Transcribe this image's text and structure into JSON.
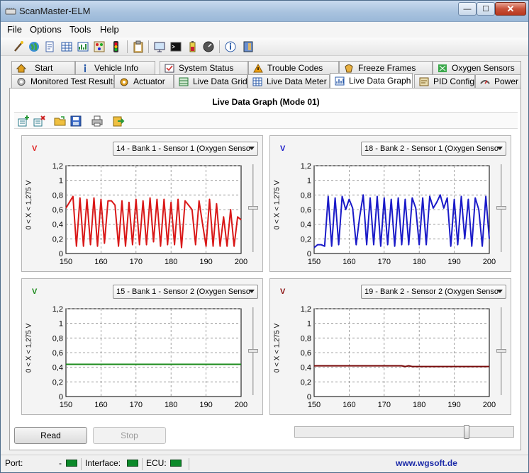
{
  "window": {
    "title": "ScanMaster-ELM",
    "minimize": "—",
    "maximize": "☐",
    "close": "✕"
  },
  "menu": [
    "File",
    "Options",
    "Tools",
    "Help"
  ],
  "toolbar_icons": [
    "wand-icon",
    "globe-icon",
    "document-icon",
    "grid-icon",
    "chart-icon",
    "palette-icon",
    "traffic-light-icon",
    "clipboard-icon",
    "monitor-icon",
    "terminal-icon",
    "battery-icon",
    "gauge-icon",
    "info-icon",
    "connect-icon"
  ],
  "tabs_back": [
    {
      "label": "Start",
      "icon": "home-icon"
    },
    {
      "label": "Vehicle Info",
      "icon": "info-icon"
    },
    {
      "label": "System Status",
      "icon": "checklist-icon"
    },
    {
      "label": "Trouble Codes",
      "icon": "warning-icon"
    },
    {
      "label": "Freeze Frames",
      "icon": "freeze-icon"
    },
    {
      "label": "Oxygen Sensors",
      "icon": "sensor-icon"
    }
  ],
  "tabs_front": [
    {
      "label": "Monitored Test Results",
      "icon": "gear-icon"
    },
    {
      "label": "Actuator",
      "icon": "actuator-icon"
    },
    {
      "label": "Live Data Grid",
      "icon": "grid-icon"
    },
    {
      "label": "Live Data Meter",
      "icon": "meter-icon"
    },
    {
      "label": "Live Data Graph",
      "icon": "graph-icon",
      "active": true
    },
    {
      "label": "PID Config",
      "icon": "config-icon"
    },
    {
      "label": "Power",
      "icon": "power-icon"
    }
  ],
  "graph_title": "Live Data Graph (Mode 01)",
  "y_axis_label": "0  < X <  1,275  V",
  "panels": [
    {
      "vlabel": "V",
      "vcolor": "#e02020",
      "pid": "14 - Bank 1 - Sensor 1 (Oxygen Senso",
      "line_color": "#d91818",
      "chart_data": {
        "type": "line",
        "xlim": [
          150,
          200
        ],
        "ylim": [
          0,
          1.2
        ],
        "x_ticks": [
          "150",
          "160",
          "170",
          "180",
          "190",
          "200"
        ],
        "y_ticks": [
          "0",
          "0,2",
          "0,4",
          "0,6",
          "0,8",
          "1",
          "1,2"
        ],
        "x": [
          150,
          151,
          152,
          153,
          154,
          155,
          156,
          157,
          158,
          159,
          160,
          161,
          162,
          163,
          164,
          165,
          166,
          167,
          168,
          169,
          170,
          171,
          172,
          173,
          174,
          175,
          176,
          177,
          178,
          179,
          180,
          181,
          182,
          183,
          184,
          185,
          186,
          187,
          188,
          189,
          190,
          191,
          192,
          193,
          194,
          195,
          196,
          197,
          198,
          199,
          200
        ],
        "y": [
          0.62,
          0.7,
          0.78,
          0.1,
          0.76,
          0.1,
          0.74,
          0.12,
          0.76,
          0.1,
          0.74,
          0.14,
          0.72,
          0.72,
          0.66,
          0.1,
          0.72,
          0.1,
          0.7,
          0.12,
          0.74,
          0.12,
          0.72,
          0.12,
          0.76,
          0.16,
          0.74,
          0.1,
          0.74,
          0.12,
          0.7,
          0.12,
          0.74,
          0.08,
          0.72,
          0.66,
          0.6,
          0.12,
          0.72,
          0.4,
          0.1,
          0.74,
          0.1,
          0.68,
          0.1,
          0.5,
          0.1,
          0.6,
          0.1,
          0.5,
          0.46
        ]
      }
    },
    {
      "vlabel": "V",
      "vcolor": "#1818c8",
      "pid": "18 - Bank 2 - Sensor 1 (Oxygen Senso",
      "line_color": "#1a1ac8",
      "chart_data": {
        "type": "line",
        "xlim": [
          150,
          200
        ],
        "ylim": [
          0,
          1.2
        ],
        "x_ticks": [
          "150",
          "160",
          "170",
          "180",
          "190",
          "200"
        ],
        "y_ticks": [
          "0",
          "0,2",
          "0,4",
          "0,6",
          "0,8",
          "1",
          "1,2"
        ],
        "x": [
          150,
          151,
          152,
          153,
          154,
          155,
          156,
          157,
          158,
          159,
          160,
          161,
          162,
          163,
          164,
          165,
          166,
          167,
          168,
          169,
          170,
          171,
          172,
          173,
          174,
          175,
          176,
          177,
          178,
          179,
          180,
          181,
          182,
          183,
          184,
          185,
          186,
          187,
          188,
          189,
          190,
          191,
          192,
          193,
          194,
          195,
          196,
          197,
          198,
          199,
          200
        ],
        "y": [
          0.08,
          0.12,
          0.12,
          0.1,
          0.78,
          0.1,
          0.76,
          0.12,
          0.78,
          0.6,
          0.74,
          0.62,
          0.12,
          0.5,
          0.8,
          0.12,
          0.76,
          0.12,
          0.78,
          0.1,
          0.76,
          0.12,
          0.74,
          0.1,
          0.76,
          0.12,
          0.74,
          0.12,
          0.76,
          0.62,
          0.12,
          0.76,
          0.12,
          0.78,
          0.62,
          0.7,
          0.8,
          0.62,
          0.76,
          0.1,
          0.74,
          0.12,
          0.78,
          0.2,
          0.74,
          0.1,
          0.76,
          0.6,
          0.1,
          0.78,
          0.2
        ]
      }
    },
    {
      "vlabel": "V",
      "vcolor": "#1a8a1a",
      "pid": "15 - Bank 1 - Sensor 2 (Oxygen Senso",
      "line_color": "#1a8a1a",
      "chart_data": {
        "type": "line",
        "xlim": [
          150,
          200
        ],
        "ylim": [
          0,
          1.2
        ],
        "x_ticks": [
          "150",
          "160",
          "170",
          "180",
          "190",
          "200"
        ],
        "y_ticks": [
          "0",
          "0,2",
          "0,4",
          "0,6",
          "0,8",
          "1",
          "1,2"
        ],
        "x": [
          150,
          200
        ],
        "y": [
          0.44,
          0.44
        ]
      }
    },
    {
      "vlabel": "V",
      "vcolor": "#8a1010",
      "pid": "19 - Bank 2 - Sensor 2 (Oxygen Senso",
      "line_color": "#7a0c0c",
      "chart_data": {
        "type": "line",
        "xlim": [
          150,
          200
        ],
        "ylim": [
          0,
          1.2
        ],
        "x_ticks": [
          "150",
          "160",
          "170",
          "180",
          "190",
          "200"
        ],
        "y_ticks": [
          "0",
          "0,2",
          "0,4",
          "0,6",
          "0,8",
          "1",
          "1,2"
        ],
        "x": [
          150,
          175,
          176,
          177,
          178,
          179,
          200
        ],
        "y": [
          0.42,
          0.42,
          0.41,
          0.42,
          0.41,
          0.41,
          0.41
        ]
      }
    }
  ],
  "buttons": {
    "read": "Read",
    "stop": "Stop"
  },
  "status": {
    "port_label": "Port:",
    "port_value": "-",
    "interface_label": "Interface:",
    "ecu_label": "ECU:",
    "link": "www.wgsoft.de"
  }
}
